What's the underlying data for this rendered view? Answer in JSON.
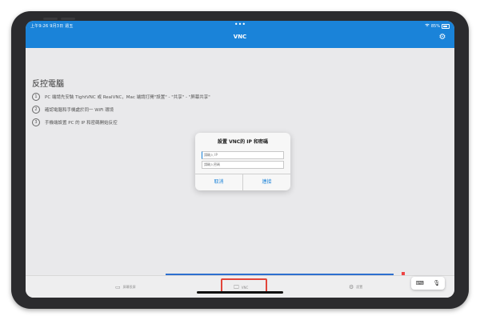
{
  "status_bar": {
    "time_date": "上午9:26  9月3日 週五",
    "dots": "•••",
    "battery": "85%"
  },
  "navbar": {
    "title": "VNC",
    "settings_icon": "gear-icon"
  },
  "main": {
    "heading": "反控電腦",
    "steps": [
      {
        "num": "1",
        "text": "PC 端請先安裝 TightVNC 或 RealVNC，Mac 端請打開\"設置\" - \"共享\" - \"屏幕共享\""
      },
      {
        "num": "2",
        "text": "確認電腦和手機處於同一 WiFi 環境"
      },
      {
        "num": "3",
        "text": "手機端設置 PC 的 IP 和密碼開始反控"
      }
    ]
  },
  "dialog": {
    "title": "設置 VNC的 IP 和密碼",
    "ip_placeholder": "請輸入 IP",
    "password_placeholder": "請輸入密碼",
    "cancel_label": "取消",
    "connect_label": "連接"
  },
  "tabbar": {
    "tabs": [
      {
        "label": "屏幕投屏",
        "icon": "screen-icon"
      },
      {
        "label": "VNC",
        "icon": "monitor-icon"
      },
      {
        "label": "設置",
        "icon": "gear-icon"
      }
    ]
  },
  "colors": {
    "accent": "#1a83d9",
    "highlight": "#e2453a",
    "background": "#e9e9eb"
  }
}
